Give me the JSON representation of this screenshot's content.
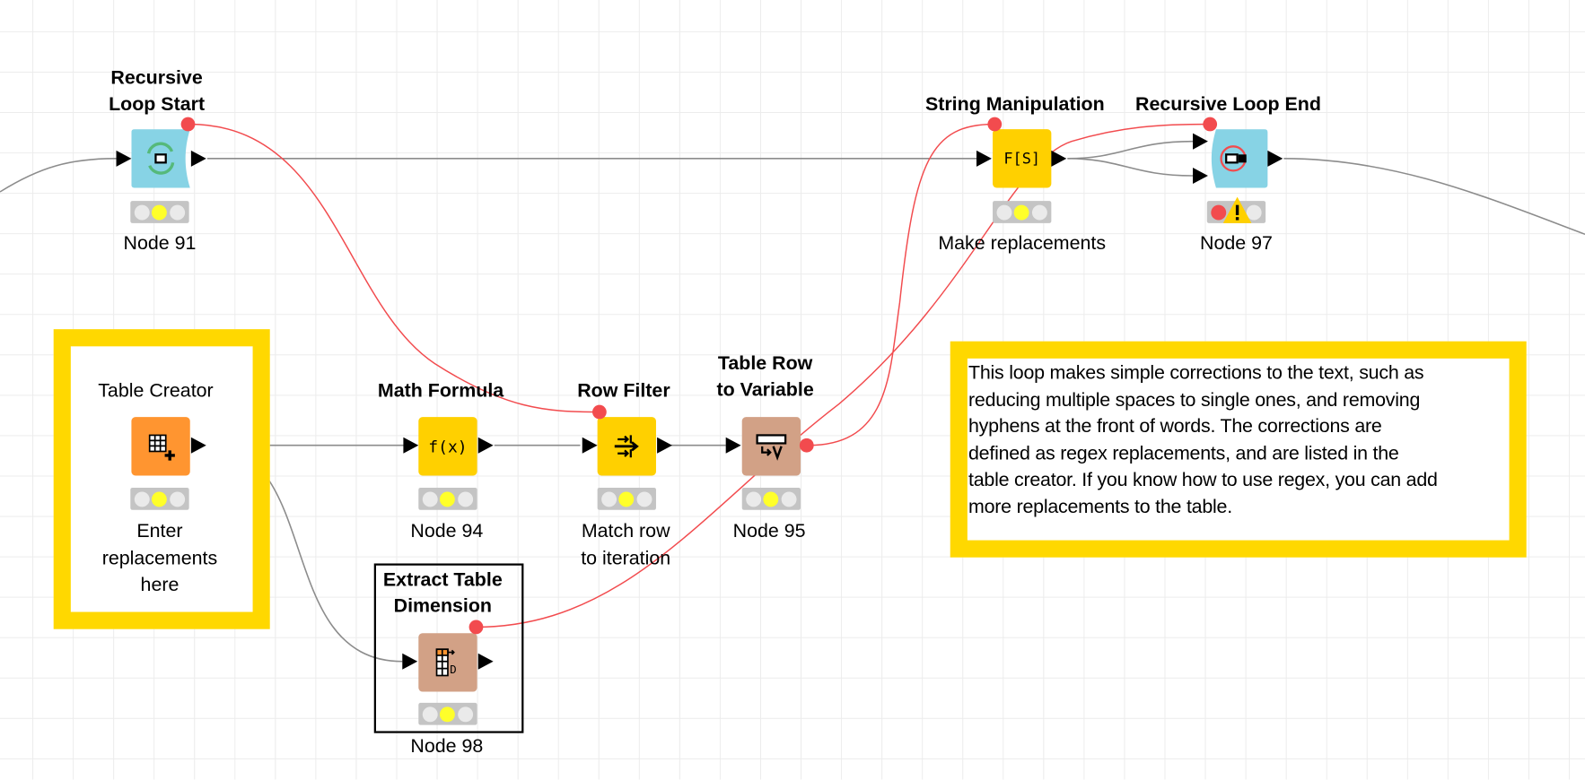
{
  "workflow": {
    "nodes": [
      {
        "id": "node-91",
        "title_lines": [
          "Recursive",
          "Loop Start"
        ],
        "label": "Node 91",
        "kind": "recursive-loop-start",
        "color": "#87d3e5",
        "status": "configured"
      },
      {
        "id": "node-string",
        "title_lines": [
          "String Manipulation"
        ],
        "label": "Make replacements",
        "kind": "string-manipulation",
        "color": "#ffd000",
        "icon_text": "F[S]",
        "status": "configured"
      },
      {
        "id": "node-97",
        "title_lines": [
          "Recursive Loop End"
        ],
        "label": "Node 97",
        "kind": "recursive-loop-end",
        "color": "#87d3e5",
        "status": "error-warning"
      },
      {
        "id": "node-table-creator",
        "title_lines": [
          "Table Creator"
        ],
        "label_lines": [
          "Enter",
          "replacements",
          "here"
        ],
        "kind": "table-creator",
        "color": "#ff9530",
        "status": "configured"
      },
      {
        "id": "node-94",
        "title_lines": [
          "Math Formula"
        ],
        "label": "Node 94",
        "kind": "math-formula",
        "color": "#ffd000",
        "icon_text": "f(x)",
        "status": "configured"
      },
      {
        "id": "node-row-filter",
        "title_lines": [
          "Row Filter"
        ],
        "label_lines": [
          "Match row",
          "to iteration"
        ],
        "kind": "row-filter",
        "color": "#ffd000",
        "status": "configured"
      },
      {
        "id": "node-95",
        "title_lines": [
          "Table Row",
          "to Variable"
        ],
        "label": "Node 95",
        "kind": "table-row-to-variable",
        "color": "#d2a186",
        "status": "configured"
      },
      {
        "id": "node-98",
        "title_lines": [
          "Extract Table",
          "Dimension"
        ],
        "label": "Node 98",
        "kind": "extract-table-dimension",
        "color": "#d2a186",
        "status": "configured",
        "selected": true
      }
    ],
    "annotations": [
      {
        "id": "annotation-table-creator",
        "border_color": "#ffd800"
      },
      {
        "id": "annotation-description",
        "border_color": "#ffd800",
        "lines": [
          "This loop makes simple corrections to the text, such as",
          "reducing multiple spaces to single ones, and removing",
          "hyphens at the front of words. The corrections are",
          "defined as regex replacements, and are listed in the",
          "table creator. If you know how to use regex, you can add",
          "more replacements to the table."
        ]
      }
    ],
    "colors": {
      "data_connection": "#8c8c8c",
      "flow_variable_connection": "#f24b4e",
      "grid": "#ececec"
    }
  }
}
